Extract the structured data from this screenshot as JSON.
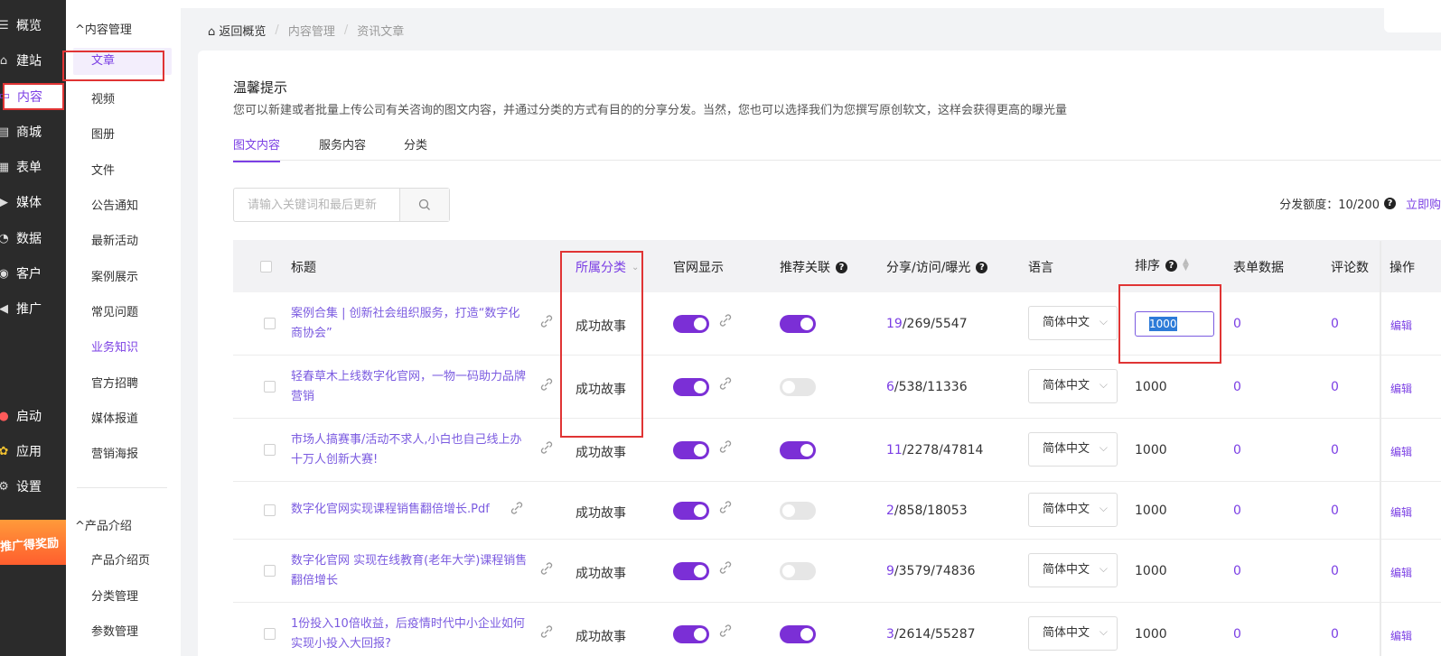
{
  "main_nav": [
    {
      "label": "概览",
      "icon": "overview-icon"
    },
    {
      "label": "建站",
      "icon": "home-icon"
    },
    {
      "label": "内容",
      "icon": "content-icon"
    },
    {
      "label": "商城",
      "icon": "shop-icon"
    },
    {
      "label": "表单",
      "icon": "form-icon"
    },
    {
      "label": "媒体",
      "icon": "media-icon"
    },
    {
      "label": "数据",
      "icon": "data-icon"
    },
    {
      "label": "客户",
      "icon": "customer-icon"
    },
    {
      "label": "推广",
      "icon": "promotion-icon"
    },
    {
      "label": "启动",
      "icon": "launch-icon"
    },
    {
      "label": "应用",
      "icon": "apps-icon"
    },
    {
      "label": "设置",
      "icon": "gear-icon"
    }
  ],
  "promo_banner": "推广得奖励",
  "sub_nav": {
    "group1": "内容管理",
    "items1": [
      "文章",
      "视频",
      "图册",
      "文件",
      "公告通知",
      "最新活动",
      "案例展示",
      "常见问题",
      "业务知识",
      "官方招聘",
      "媒体报道",
      "营销海报"
    ],
    "group2": "产品介绍",
    "items2": [
      "产品介绍页",
      "分类管理",
      "参数管理"
    ]
  },
  "breadcrumb": {
    "home": "返回概览",
    "level1": "内容管理",
    "level2": "资讯文章",
    "sep": "/"
  },
  "tip": {
    "title": "温馨提示",
    "desc": "您可以新建或者批量上传公司有关咨询的图文内容，并通过分类的方式有目的的分享分发。当然，您也可以选择我们为您撰写原创软文，这样会获得更高的曝光量"
  },
  "tabs": [
    "图文内容",
    "服务内容",
    "分类"
  ],
  "search": {
    "placeholder": "请输入关键词和最后更新"
  },
  "quota": {
    "label": "分发额度：10/200",
    "link": "立即购"
  },
  "table": {
    "headers": {
      "title": "标题",
      "category": "所属分类",
      "official": "官网显示",
      "related": "推荐关联",
      "stats": "分享/访问/曝光",
      "lang": "语言",
      "sort": "排序",
      "form": "表单数据",
      "comments": "评论数",
      "ops": "操作"
    },
    "rows": [
      {
        "title": "案例合集 | 创新社会组织服务，打造“数字化商协会”",
        "category": "成功故事",
        "official": true,
        "related": true,
        "share": "19",
        "rest": "/269/5547",
        "lang": "简体中文",
        "sort": "1000",
        "form": "0",
        "comments": "0",
        "op": "编辑"
      },
      {
        "title": "轻春草木上线数字化官网，一物一码助力品牌营销",
        "category": "成功故事",
        "official": true,
        "related": false,
        "share": "6",
        "rest": "/538/11336",
        "lang": "简体中文",
        "sort": "1000",
        "form": "0",
        "comments": "0",
        "op": "编辑"
      },
      {
        "title": "市场人搞赛事/活动不求人,小白也自己线上办十万人创新大赛!",
        "category": "成功故事",
        "official": true,
        "related": true,
        "share": "11",
        "rest": "/2278/47814",
        "lang": "简体中文",
        "sort": "1000",
        "form": "0",
        "comments": "0",
        "op": "编辑"
      },
      {
        "title": "数字化官网实现课程销售翻倍增长.Pdf",
        "category": "成功故事",
        "official": true,
        "related": false,
        "share": "2",
        "rest": "/858/18053",
        "lang": "简体中文",
        "sort": "1000",
        "form": "0",
        "comments": "0",
        "op": "编辑"
      },
      {
        "title": "数字化官网 实现在线教育(老年大学)课程销售翻倍增长",
        "category": "成功故事",
        "official": true,
        "related": false,
        "share": "9",
        "rest": "/3579/74836",
        "lang": "简体中文",
        "sort": "1000",
        "form": "0",
        "comments": "0",
        "op": "编辑"
      },
      {
        "title": "1份投入10倍收益，后疫情时代中小企业如何实现小投入大回报?",
        "category": "成功故事",
        "official": true,
        "related": true,
        "share": "3",
        "rest": "/2614/55287",
        "lang": "简体中文",
        "sort": "1000",
        "form": "0",
        "comments": "0",
        "op": "编辑"
      }
    ]
  },
  "colors": {
    "accent": "#7b3fe4",
    "highlight": "#e03434",
    "nav_bg": "#2b2b2b"
  }
}
